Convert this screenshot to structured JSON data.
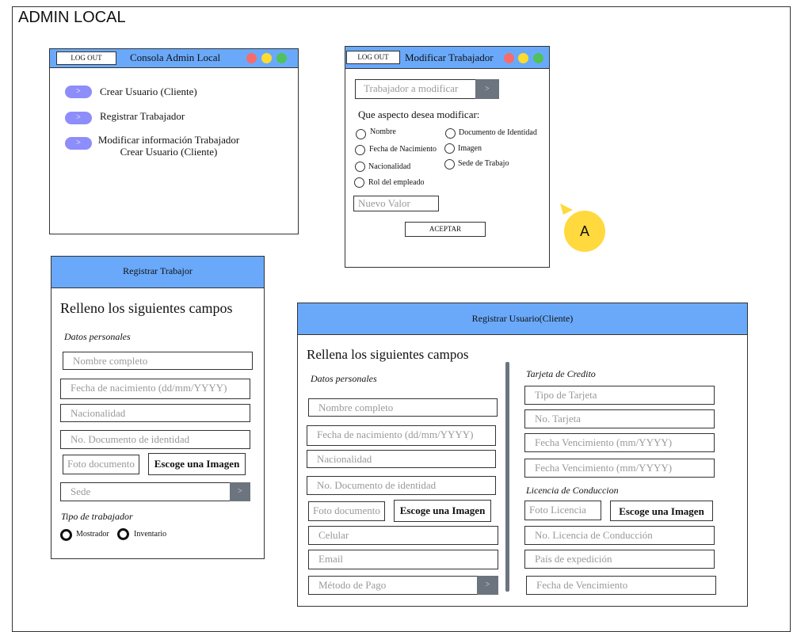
{
  "page": {
    "title": "ADMIN LOCAL"
  },
  "consola": {
    "logout": "LOG OUT",
    "title": "Consola Admin Local",
    "pill_glyph": ">",
    "items": [
      "Crear Usuario (Cliente)",
      "Registrar Trabajador",
      "Modificar información Trabajador",
      "Crear Usuario (Cliente)"
    ]
  },
  "modificar": {
    "logout": "LOG OUT",
    "title": "Modificar Trabajador",
    "select_placeholder": "Trabajador a modificar",
    "select_glyph": ">",
    "question": "Que aspecto desea modificar:",
    "options": [
      "Nombre",
      "Documento de Identidad",
      "Fecha de Nacimiento",
      "Imagen",
      "Nacionalidad",
      "Sede de Trabajo",
      "Rol del empleado"
    ],
    "new_value_placeholder": "Nuevo Valor",
    "accept": "ACEPTAR"
  },
  "badge": "A",
  "registrar_trabajador": {
    "header": "Registrar Trabajor",
    "heading": "Relleno los siguientes campos",
    "section": "Datos personales",
    "name": "Nombre completo",
    "birth": "Fecha de nacimiento (dd/mm/YYYY)",
    "nationality": "Nacionalidad",
    "id_doc": "No. Documento de identidad",
    "photo": "Foto documento",
    "choose_image": "Escoge una Imagen",
    "sede": "Sede",
    "sede_glyph": ">",
    "worker_type": "Tipo de trabajador",
    "types": [
      "Mostrador",
      "Inventario"
    ]
  },
  "registrar_usuario": {
    "header": "Registrar Usuario(Cliente)",
    "heading": "Rellena los siguientes campos",
    "section_personal": "Datos personales",
    "name": "Nombre completo",
    "birth": "Fecha de nacimiento (dd/mm/YYYY)",
    "nationality": "Nacionalidad",
    "id_doc": "No. Documento de identidad",
    "photo": "Foto documento",
    "choose_image": "Escoge una Imagen",
    "phone": "Celular",
    "email": "Email",
    "payment": "Método de Pago",
    "payment_glyph": ">",
    "section_card": "Tarjeta de Credito",
    "card_type": "Tipo de Tarjeta",
    "card_no": "No. Tarjeta",
    "card_exp1": "Fecha Vencimiento (mm/YYYY)",
    "card_exp2": "Fecha Vencimiento (mm/YYYY)",
    "section_license": "Licencia de Conduccion",
    "license_photo": "Foto Licencia",
    "license_choose": "Escoge una Imagen",
    "license_no": "No. Licencia de Conducción",
    "license_country": "País de expedición",
    "license_exp": "Fecha de Vencimiento"
  },
  "colors": {
    "titlebar": "#6aa9fa",
    "pill": "#8d8dfb",
    "red": "#f86b6b",
    "yellow": "#ffdb2e",
    "green": "#4fc25a",
    "badge": "#ffd93d"
  }
}
